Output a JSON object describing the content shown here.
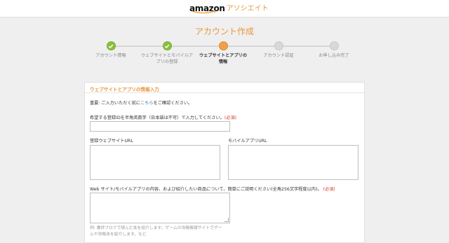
{
  "header": {
    "logo_word": "amazon",
    "logo_suffix": "アソシエイト"
  },
  "page_title": "アカウント作成",
  "steps": [
    {
      "label_line1": "アカウント情報",
      "label_line2": "",
      "state": "done"
    },
    {
      "label_line1": "ウェブサイトとモバイルア",
      "label_line2": "プリの登録",
      "state": "done"
    },
    {
      "label_line1": "ウェブサイトとアプリの",
      "label_line2": "情報",
      "state": "current"
    },
    {
      "label_line1": "アカウント認証",
      "label_line2": "",
      "state": "todo"
    },
    {
      "label_line1": "お申し込み完了",
      "label_line2": "",
      "state": "todo"
    }
  ],
  "colors": {
    "accent": "#e8963c",
    "done": "#8bbf3c",
    "current": "#f0a04b",
    "todo": "#d8d8d8",
    "required": "#d43b2b",
    "link": "#3a76b9"
  },
  "form": {
    "section_title": "ウェブサイトとアプリの情報入力",
    "notice_prefix": "重要",
    "notice_before_link": ": ご入力いただく前に",
    "notice_link": "こちら",
    "notice_after_link": "をご確認ください。",
    "id_label": "希望する登録IDを半角英数字（日本語は不可）で入力してください。",
    "required_mark": "(必須)",
    "id_value": "",
    "website_label": "登録ウェブサイトURL",
    "website_value": "",
    "mobile_label": "モバイルアプリURL",
    "mobile_value": "",
    "description_label": "Web サイト/モバイルアプリの内容、および紹介したい商品について、簡単にご説明ください(全角256文字程度以内)。",
    "description_value": "",
    "hint_line1": "例: 書評ブログで読んだ本を紹介します。ゲームの攻略情報サイトでゲー",
    "hint_line2": "ムや攻略本を紹介します。など"
  }
}
